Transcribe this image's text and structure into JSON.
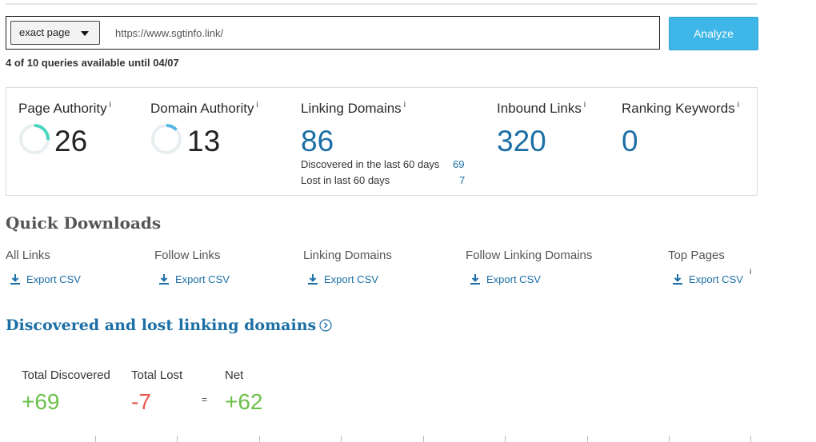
{
  "search": {
    "scope_selected": "exact page",
    "url_value": "https://www.sgtinfo.link/",
    "analyze_label": "Analyze",
    "quota_text": "4 of 10 queries available until 04/07"
  },
  "metrics": {
    "page_authority": {
      "label": "Page Authority",
      "info": "i",
      "value": "26",
      "gauge_fraction": 0.26
    },
    "domain_authority": {
      "label": "Domain Authority",
      "info": "i",
      "value": "13",
      "gauge_fraction": 0.13
    },
    "linking_domains": {
      "label": "Linking Domains",
      "info": "i",
      "value": "86",
      "discovered_label": "Discovered in the last 60 days",
      "discovered_value": "69",
      "lost_label": "Lost in last 60 days",
      "lost_value": "7"
    },
    "inbound_links": {
      "label": "Inbound Links",
      "info": "i",
      "value": "320"
    },
    "ranking_keywords": {
      "label": "Ranking Keywords",
      "info": "i",
      "value": "0"
    }
  },
  "quick_downloads": {
    "title": "Quick Downloads",
    "items": [
      {
        "title": "All Links",
        "link": "Export CSV"
      },
      {
        "title": "Follow Links",
        "link": "Export CSV"
      },
      {
        "title": "Linking Domains",
        "link": "Export CSV"
      },
      {
        "title": "Follow Linking Domains",
        "link": "Export CSV"
      },
      {
        "title": "Top Pages",
        "link": "Export CSV",
        "info": "i"
      }
    ]
  },
  "discovered_lost": {
    "heading": "Discovered and lost linking domains",
    "total_discovered_label": "Total Discovered",
    "total_discovered_value": "+69",
    "total_lost_label": "Total Lost",
    "total_lost_value": "-7",
    "equals": "=",
    "net_label": "Net",
    "net_value": "+62"
  },
  "colors": {
    "accent_blue": "#1b6fa6",
    "button_blue": "#3fb6e8",
    "gauge_teal": "#4ad6c0",
    "positive_green": "#6cc04a",
    "negative_red": "#e8584d"
  }
}
